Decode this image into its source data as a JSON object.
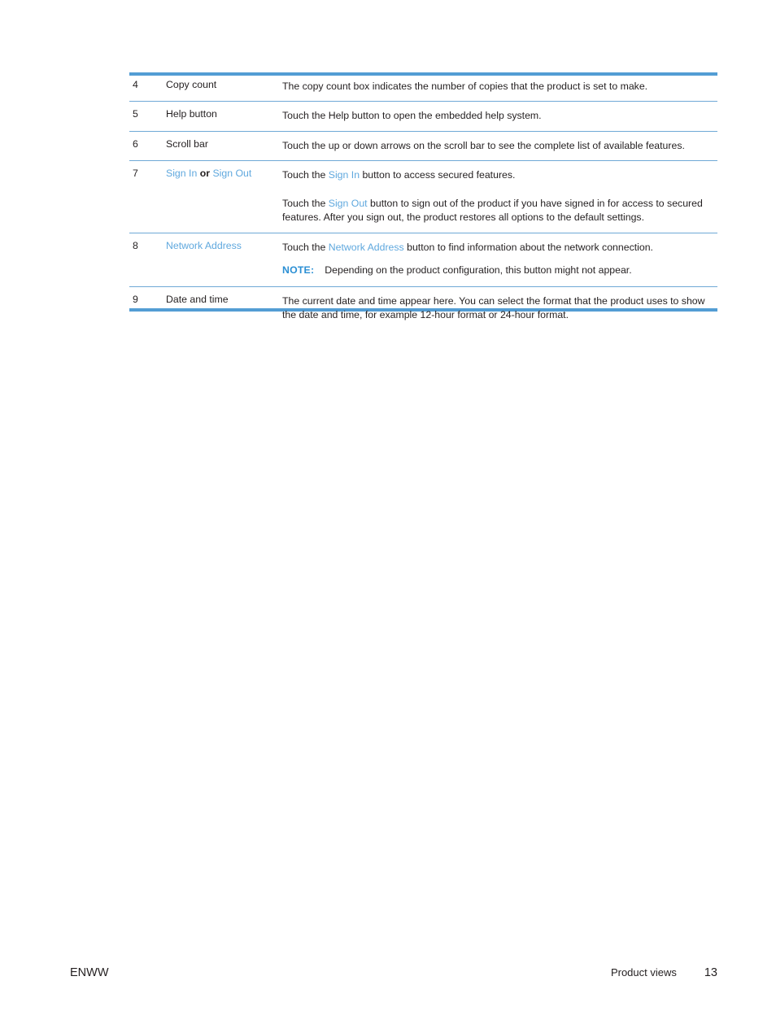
{
  "document": {
    "type": "printed-manual-page",
    "accent_color": "#539dd4",
    "link_color": "#5fa8de",
    "note_color": "#2b8fd4",
    "text_color": "#231f20"
  },
  "table": {
    "rows": [
      {
        "number": "4",
        "name": "Copy count",
        "description": "The copy count box indicates the number of copies that the product is set to make."
      },
      {
        "number": "5",
        "name": "Help button",
        "description": "Touch the Help button to open the embedded help system."
      },
      {
        "number": "6",
        "name": "Scroll bar",
        "description": "Touch the up or down arrows on the scroll bar to see the complete list of available features."
      },
      {
        "number": "7",
        "name_parts": {
          "term_one": "Sign In",
          "conjunction": "or",
          "term_two": "Sign Out"
        },
        "paragraph_one": {
          "lead": "Touch the ",
          "term": "Sign In",
          "tail": " button to access secured features."
        },
        "paragraph_two": {
          "lead": "Touch the ",
          "term": "Sign Out",
          "tail": " button to sign out of the product if you have signed in for access to secured features. After you sign out, the product restores all options to the default settings."
        }
      },
      {
        "number": "8",
        "name": "Network Address",
        "paragraph_one": {
          "lead": "Touch the ",
          "term": "Network Address",
          "tail": " button to find information about the network connection."
        },
        "note": {
          "label": "NOTE:",
          "text": "Depending on the product configuration, this button might not appear."
        }
      },
      {
        "number": "9",
        "name": "Date and time",
        "description": "The current date and time appear here. You can select the format that the product uses to show the date and time, for example 12-hour format or 24-hour format."
      }
    ]
  },
  "footer": {
    "left": "ENWW",
    "section": "Product views",
    "page_number": "13"
  }
}
